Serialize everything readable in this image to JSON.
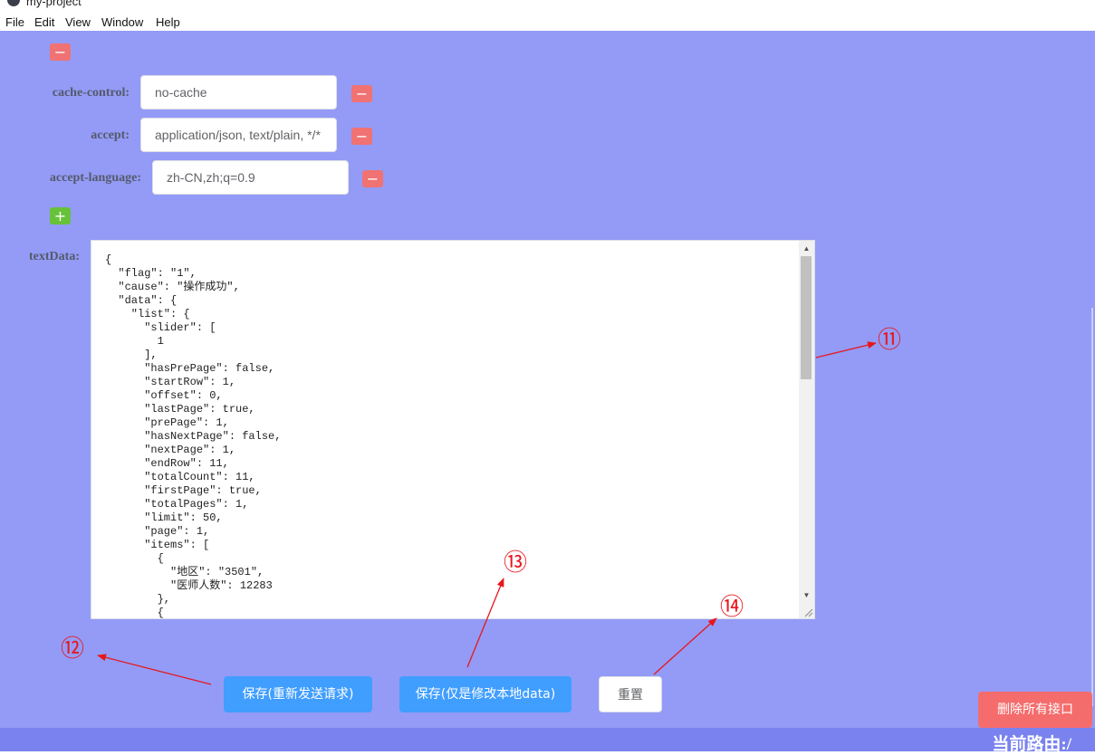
{
  "window": {
    "title": "my-project"
  },
  "menu": [
    "File",
    "Edit",
    "View",
    "Window",
    "Help"
  ],
  "headers": [
    {
      "key": "cache-control:",
      "value": "no-cache"
    },
    {
      "key": "accept:",
      "value": "application/json, text/plain, */*"
    },
    {
      "key": "accept-language:",
      "value": "zh-CN,zh;q=0.9"
    }
  ],
  "buttons": {
    "minus": "−",
    "plus": "+"
  },
  "text_data": {
    "label": "textData:",
    "content": "{\n  \"flag\": \"1\",\n  \"cause\": \"操作成功\",\n  \"data\": {\n    \"list\": {\n      \"slider\": [\n        1\n      ],\n      \"hasPrePage\": false,\n      \"startRow\": 1,\n      \"offset\": 0,\n      \"lastPage\": true,\n      \"prePage\": 1,\n      \"hasNextPage\": false,\n      \"nextPage\": 1,\n      \"endRow\": 11,\n      \"totalCount\": 11,\n      \"firstPage\": true,\n      \"totalPages\": 1,\n      \"limit\": 50,\n      \"page\": 1,\n      \"items\": [\n        {\n          \"地区\": \"3501\",\n          \"医师人数\": 12283\n        },\n        {"
  },
  "actions": {
    "save_resend": "保存(重新发送请求)",
    "save_local": "保存(仅是修改本地data)",
    "reset": "重置",
    "delete_all": "删除所有接口"
  },
  "footer": {
    "route": "当前路由:/"
  },
  "annotations": [
    "⑪",
    "⑫",
    "⑬",
    "⑭"
  ],
  "colors": {
    "background": "#939bf6",
    "footer": "#7a82ef",
    "primary": "#409eff",
    "danger": "#f56c6c",
    "success": "#67c23a",
    "annotation": "#e8161b"
  }
}
